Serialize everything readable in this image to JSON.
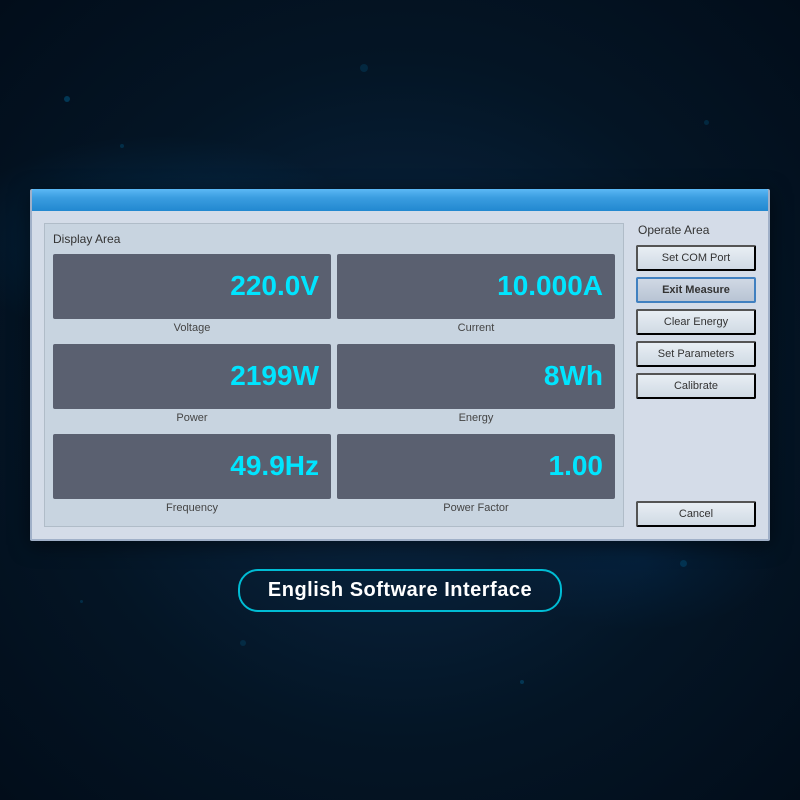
{
  "background": {
    "color": "#041525"
  },
  "dialog": {
    "display_area_title": "Display Area",
    "operate_area_title": "Operate Area",
    "metrics": [
      {
        "id": "voltage",
        "value": "220.0V",
        "label": "Voltage"
      },
      {
        "id": "current",
        "value": "10.000A",
        "label": "Current"
      },
      {
        "id": "power",
        "value": "2199W",
        "label": "Power"
      },
      {
        "id": "energy",
        "value": "8Wh",
        "label": "Energy"
      },
      {
        "id": "frequency",
        "value": "49.9Hz",
        "label": "Frequency"
      },
      {
        "id": "power-factor",
        "value": "1.00",
        "label": "Power Factor"
      }
    ],
    "buttons": [
      {
        "id": "set-com-port",
        "label": "Set COM Port",
        "active": false
      },
      {
        "id": "exit-measure",
        "label": "Exit Measure",
        "active": true
      },
      {
        "id": "clear-energy",
        "label": "Clear Energy",
        "active": false
      },
      {
        "id": "set-parameters",
        "label": "Set Parameters",
        "active": false
      },
      {
        "id": "calibrate",
        "label": "Calibrate",
        "active": false
      },
      {
        "id": "cancel",
        "label": "Cancel",
        "active": false
      }
    ]
  },
  "bottom_label": "English Software Interface"
}
